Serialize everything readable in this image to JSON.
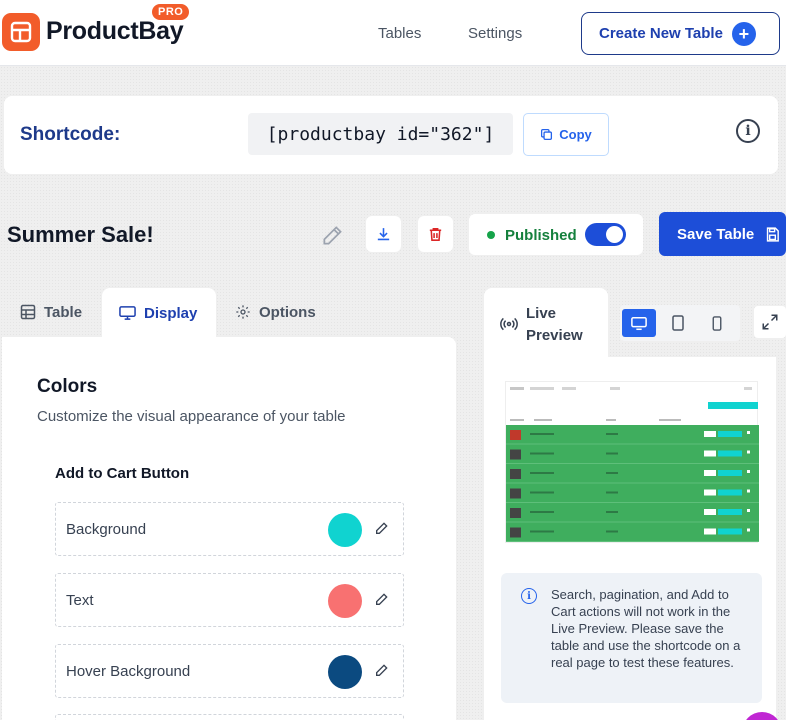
{
  "header": {
    "brand": "ProductBay",
    "badge": "PRO",
    "nav": [
      "Tables",
      "Settings"
    ],
    "create_label": "Create New Table",
    "accent": "#f25c2a"
  },
  "shortcode": {
    "label": "Shortcode:",
    "code": "[productbay id=\"362\"]",
    "copy_label": "Copy",
    "info_glyph": "i"
  },
  "table": {
    "title": "Summer Sale!",
    "status": "Published",
    "published": true,
    "save_label": "Save Table"
  },
  "tabs": [
    {
      "label": "Table",
      "icon": "grid-icon"
    },
    {
      "label": "Display",
      "icon": "monitor-icon",
      "active": true
    },
    {
      "label": "Options",
      "icon": "gear-icon"
    }
  ],
  "colors": {
    "title": "Colors",
    "subtitle": "Customize the visual appearance of your table",
    "section": "Add to Cart Button",
    "rows": [
      {
        "label": "Background",
        "color": "#10d3d0"
      },
      {
        "label": "Text",
        "color": "#f87171"
      },
      {
        "label": "Hover Background",
        "color": "#0b4a80"
      }
    ]
  },
  "preview": {
    "tab_label": "Live Preview",
    "devices": [
      "desktop",
      "tablet",
      "mobile"
    ],
    "active_device": "desktop",
    "table_color": "#3fae5e",
    "button_color": "#10d3d0",
    "notice": "Search, pagination, and Add to Cart actions will not work in the Live Preview. Please save the table and use the shortcode on a real page to test these features."
  }
}
